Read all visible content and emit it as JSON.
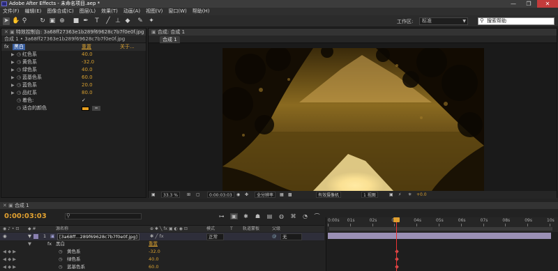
{
  "app": {
    "title": "Adobe After Effects - 未命名项目.aep *",
    "window_controls": [
      "—",
      "❐",
      "✕"
    ]
  },
  "menu": [
    "文件(F)",
    "编辑(E)",
    "图像合成(C)",
    "图层(L)",
    "效果(T)",
    "动画(A)",
    "视图(V)",
    "窗口(W)",
    "帮助(H)"
  ],
  "toolbar": {
    "tools": [
      "selection-tool",
      "hand-tool",
      "zoom-tool",
      "rotate-tool",
      "camera-tool",
      "pan-behind-tool",
      "rectangle-tool",
      "pen-tool",
      "type-tool",
      "brush-tool",
      "clone-stamp-tool",
      "eraser-tool",
      "roto-brush-tool",
      "puppet-tool"
    ],
    "workspace_label": "工作区:",
    "workspace_value": "标准",
    "search_placeholder": "搜索帮助"
  },
  "effects_panel": {
    "tab_label": "特效控制台: 3a68ff27363e1b289f69628c7b7f0e0f.jpg",
    "subtitle": "合成 1 • 3a68ff27363e1b289f69628c7b7f0e0f.jpg",
    "effect": {
      "fx": "fx",
      "name": "黑白",
      "reset": "重置",
      "about": "关于..."
    },
    "properties": [
      {
        "label": "红色系",
        "value": "40.0"
      },
      {
        "label": "黄色系",
        "value": "-32.0"
      },
      {
        "label": "绿色系",
        "value": "40.0"
      },
      {
        "label": "蓝基色系",
        "value": "60.0"
      },
      {
        "label": "蓝色系",
        "value": "20.0"
      },
      {
        "label": "品红系",
        "value": "80.0"
      }
    ],
    "tint": {
      "label": "着色:",
      "value": "✓"
    },
    "tint_color": {
      "label": "适合的颜色",
      "color": "#e8a020"
    }
  },
  "comp_panel": {
    "tab_label": "合成: 合成 1",
    "sub_tab": "合成 1",
    "footer": {
      "zoom": "33.3 %",
      "timecode": "0:00:03:03",
      "resolution": "全分辨率",
      "camera": "有效摄像机",
      "views": "1 视图",
      "exposure": "+0.0"
    }
  },
  "timeline": {
    "tab_label": "合成 1",
    "timecode": "0:00:03:03",
    "search_placeholder": "",
    "columns": [
      "源名称",
      "模式",
      "T",
      "轨道蒙板",
      "父级"
    ],
    "ruler_ticks": [
      "0:00s",
      "01s",
      "02s",
      "03s",
      "04s",
      "05s",
      "06s",
      "07s",
      "08s",
      "09s",
      "10s"
    ],
    "layer": {
      "index": "1",
      "name": "[3a68ff...289f69628c7b7f0e0f.jpg]",
      "mode": "正常",
      "parent": "无"
    },
    "effect_row": {
      "fx": "fx",
      "name": "黑白",
      "reset": "重置"
    },
    "sub_props": [
      {
        "label": "黄色系",
        "value": "-32.0"
      },
      {
        "label": "绿色系",
        "value": "40.0"
      },
      {
        "label": "蓝基色系",
        "value": "60.0"
      }
    ]
  }
}
